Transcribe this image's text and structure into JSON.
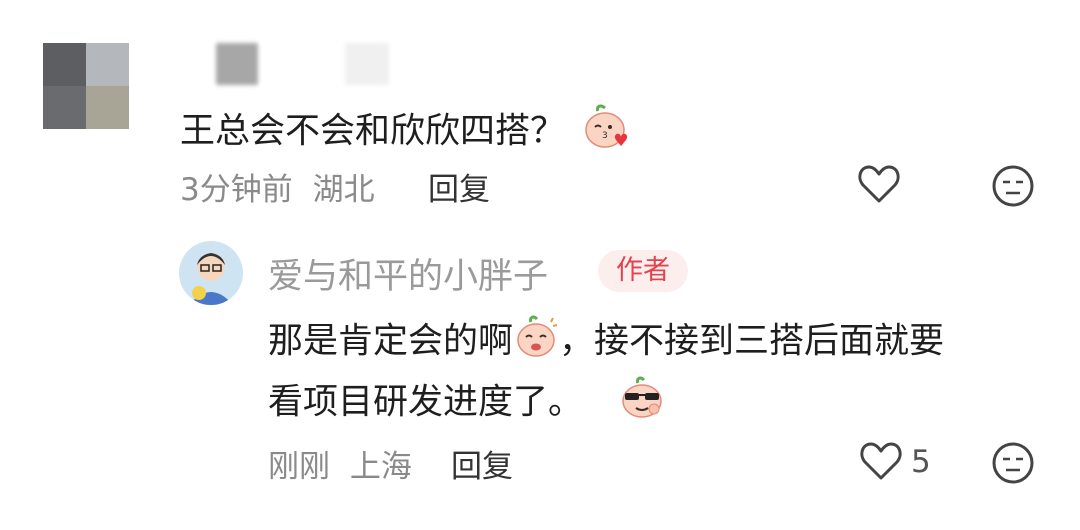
{
  "comment": {
    "text": "王总会不会和欣欣四搭？",
    "time": "3分钟前",
    "location": "湖北",
    "reply_label": "回复",
    "icons": {
      "emoji": "blowing-kiss-peach-emoji",
      "like": "heart-outline-icon",
      "dislike": "meh-face-icon"
    }
  },
  "reply": {
    "username": "爱与和平的小胖子",
    "badge": "作者",
    "line1_a": "那是肯定会的啊",
    "line1_b": "，接不接到三搭后面就要",
    "line2": "看项目研发进度了。",
    "time": "刚刚",
    "location": "上海",
    "reply_label": "回复",
    "like_count": "5",
    "icons": {
      "emoji1": "sweat-smile-peach-emoji",
      "emoji2": "cool-sunglasses-peach-emoji",
      "like": "heart-outline-icon",
      "dislike": "meh-face-icon"
    }
  },
  "colors": {
    "badge_bg": "#fdeeee",
    "badge_text": "#e0454f",
    "meta": "#8a8a8a"
  }
}
